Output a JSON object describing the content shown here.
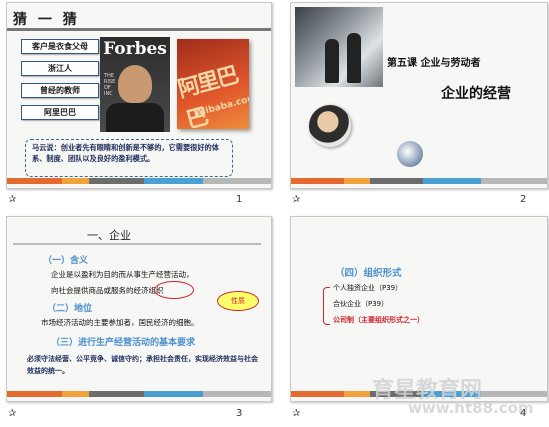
{
  "slides": [
    {
      "number": "1",
      "title": "猜 一 猜",
      "tags": [
        "客户是衣食父母",
        "浙江人",
        "曾经的教师",
        "阿里巴巴"
      ],
      "forbes": {
        "title": "Forbes",
        "lines": "THE\nRISE\nOF\nINC"
      },
      "alibaba": {
        "logo": "阿里巴巴",
        "url": "Alibaba.com"
      },
      "quote": "马云说：创业者先有眼睛和创新是不够的，它需要很好的体系、制度、团队以及良好的盈利模式。"
    },
    {
      "number": "2",
      "course": "第五课 企业与劳动者",
      "title": "企业的经营"
    },
    {
      "number": "3",
      "title": "一、企业",
      "h1": "（一）含义",
      "t1": "企业是以盈利为目的而从事生产经营活动，",
      "t2": "向社会提供商品或服务的经济组织",
      "bubble": "性质",
      "h2": "（二）地位",
      "t3": "市场经济活动的主要参加者，国民经济的细胞。",
      "h3": "（三）进行生产经营活动的基本要求",
      "note": "必须守法经营、公平竞争、诚信守约；承担社会责任，实现经济效益与社会效益的统一。"
    },
    {
      "number": "4",
      "heading": "（四）组织形式",
      "items": [
        "个人独资企业（P39）",
        "合伙企业（P39）",
        "公司制（主要组织形式之一）"
      ],
      "watermark_cn": "育星教育网",
      "watermark_url": "www.ht88.com"
    }
  ],
  "star": "✰"
}
